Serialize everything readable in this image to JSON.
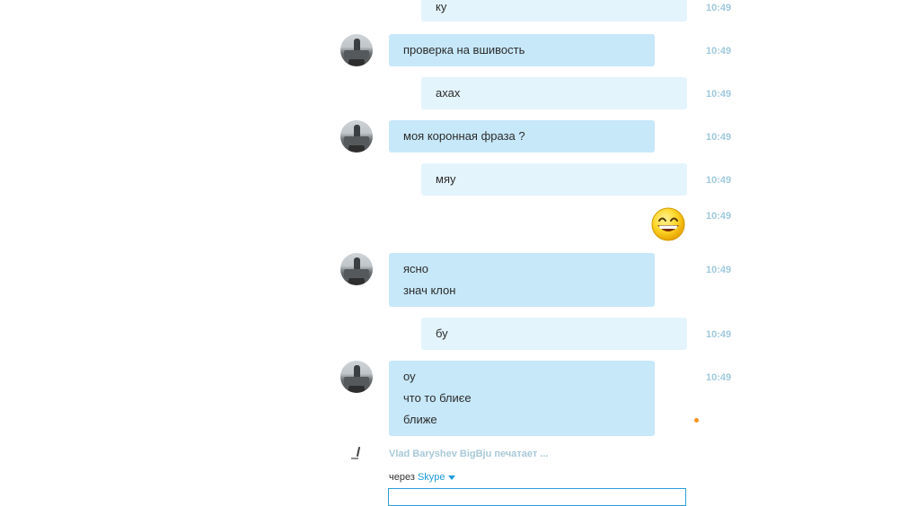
{
  "messages": [
    {
      "id": "m1",
      "dir": "out",
      "lines": [
        "ку"
      ],
      "time": "10:49"
    },
    {
      "id": "m2",
      "dir": "in",
      "lines": [
        "проверка на вшивость"
      ],
      "time": "10:49"
    },
    {
      "id": "m3",
      "dir": "out",
      "lines": [
        "ахах"
      ],
      "time": "10:49"
    },
    {
      "id": "m4",
      "dir": "in",
      "lines": [
        "моя коронная фраза ?"
      ],
      "time": "10:49"
    },
    {
      "id": "m5",
      "dir": "out",
      "lines": [
        "мяу"
      ],
      "time": "10:49"
    },
    {
      "id": "m6",
      "dir": "out",
      "emoji": "grinning-smiley-emoticon",
      "time": "10:49"
    },
    {
      "id": "m7",
      "dir": "in",
      "lines": [
        "ясно",
        "знач клон"
      ],
      "time": "10:49"
    },
    {
      "id": "m8",
      "dir": "out",
      "lines": [
        "бу"
      ],
      "time": "10:49"
    },
    {
      "id": "m9",
      "dir": "in",
      "lines": [
        "оу",
        "что то блиєе",
        "ближе"
      ],
      "time": "10:49"
    }
  ],
  "status": {
    "typing_icon": "pencil-icon",
    "typing_text": "Vlad Baryshev BigBju печатает ..."
  },
  "composer": {
    "via_label": "через",
    "via_service": "Skype"
  },
  "colors": {
    "incoming_bubble": "#c7e8f9",
    "outgoing_bubble": "#e4f4fc",
    "timestamp": "#9fc9dd",
    "link": "#1c9ad6",
    "unread_dot": "#f7941d"
  }
}
